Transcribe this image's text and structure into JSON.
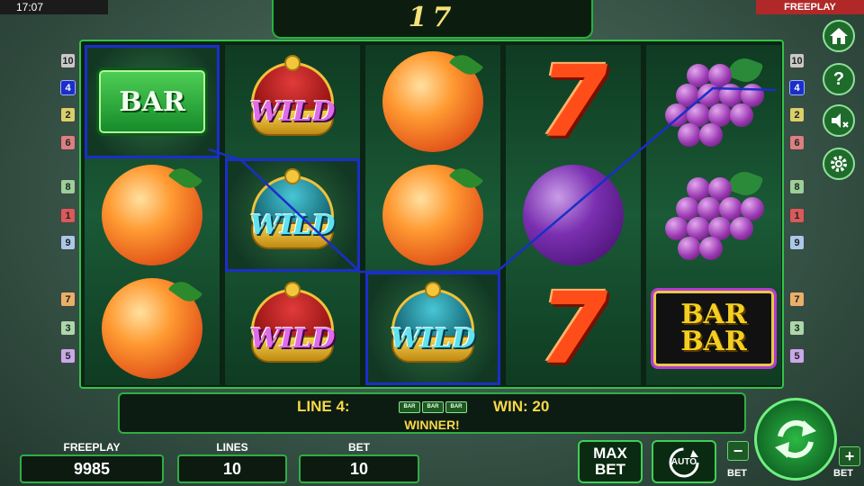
{
  "status": {
    "time": "17:07",
    "mode": "FREEPLAY"
  },
  "counter": "17",
  "paylines_left": [
    "10",
    "4",
    "2",
    "6",
    "8",
    "1",
    "9",
    "7",
    "3",
    "5"
  ],
  "paylines_right": [
    "10",
    "4",
    "2",
    "6",
    "8",
    "1",
    "9",
    "7",
    "3",
    "5"
  ],
  "active_payline": "4",
  "reels": [
    [
      "BAR",
      "orange",
      "orange"
    ],
    [
      "WILD",
      "WILD",
      "WILD"
    ],
    [
      "orange",
      "orange",
      "WILD"
    ],
    [
      "7",
      "plum",
      "7"
    ],
    [
      "grapes",
      "grapes",
      "BAR BAR"
    ]
  ],
  "symbols": {
    "bar": "BAR",
    "wild": "WILD",
    "seven": "7",
    "barbar_top": "BAR",
    "barbar_bottom": "BAR"
  },
  "win": {
    "line_label": "LINE 4:",
    "win_label": "WIN: 20",
    "message": "WINNER!",
    "mini_symbols": [
      "BAR",
      "BAR",
      "BAR"
    ]
  },
  "stats": {
    "freeplay_label": "FREEPLAY",
    "freeplay_value": "9985",
    "lines_label": "LINES",
    "lines_value": "10",
    "bet_label": "BET",
    "bet_value": "10"
  },
  "buttons": {
    "max_bet_top": "MAX",
    "max_bet_bottom": "BET",
    "auto": "AUTO",
    "bet_minus": "−",
    "bet_plus": "+",
    "bet_sub_label": "BET"
  },
  "icons": [
    "home-icon",
    "help-icon",
    "sound-muted-icon",
    "settings-icon",
    "spin-icon"
  ]
}
